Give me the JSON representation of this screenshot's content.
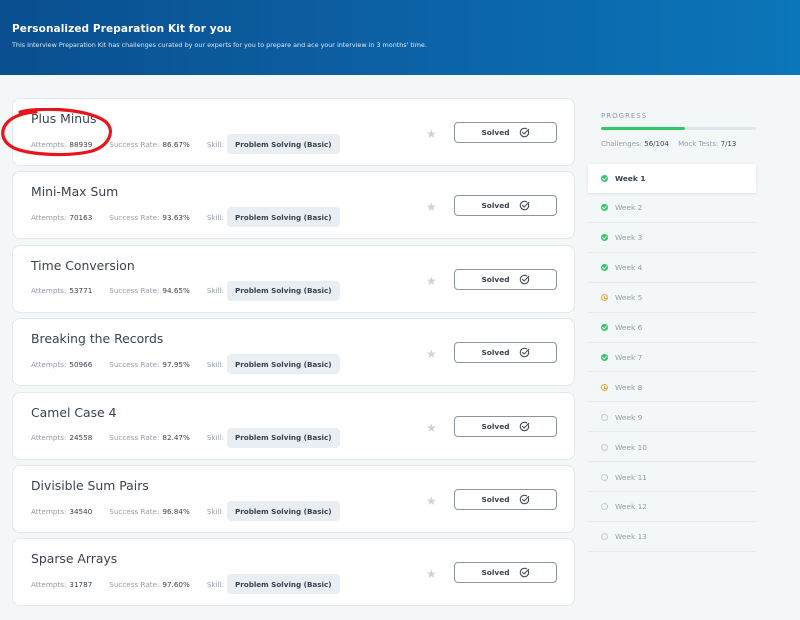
{
  "banner": {
    "title": "Personalized Preparation Kit for you",
    "subtitle": "This Interview Preparation Kit has challenges curated by our experts for you to prepare and ace your interview in 3 months' time."
  },
  "labels": {
    "attempts": "Attempts:",
    "success_rate": "Success Rate:",
    "skill": "Skill:",
    "solved": "Solved"
  },
  "challenges": [
    {
      "title": "Plus Minus",
      "attempts": "88939",
      "success_rate": "86.67%",
      "skill": "Problem Solving (Basic)"
    },
    {
      "title": "Mini-Max Sum",
      "attempts": "70163",
      "success_rate": "93.63%",
      "skill": "Problem Solving (Basic)"
    },
    {
      "title": "Time Conversion",
      "attempts": "53771",
      "success_rate": "94.65%",
      "skill": "Problem Solving (Basic)"
    },
    {
      "title": "Breaking the Records",
      "attempts": "50966",
      "success_rate": "97.95%",
      "skill": "Problem Solving (Basic)"
    },
    {
      "title": "Camel Case 4",
      "attempts": "24558",
      "success_rate": "82.47%",
      "skill": "Problem Solving (Basic)"
    },
    {
      "title": "Divisible Sum Pairs",
      "attempts": "34540",
      "success_rate": "96.84%",
      "skill": "Problem Solving (Basic)"
    },
    {
      "title": "Sparse Arrays",
      "attempts": "31787",
      "success_rate": "97.60%",
      "skill": "Problem Solving (Basic)"
    }
  ],
  "progress": {
    "label": "PROGRESS",
    "fraction": 0.54,
    "challenges_label": "Challenges:",
    "challenges_value": "56/104",
    "mock_label": "Mock Tests:",
    "mock_value": "7/13"
  },
  "weeks": [
    {
      "label": "Week 1",
      "status": "done",
      "active": true
    },
    {
      "label": "Week 2",
      "status": "done"
    },
    {
      "label": "Week 3",
      "status": "done"
    },
    {
      "label": "Week 4",
      "status": "done"
    },
    {
      "label": "Week 5",
      "status": "progress"
    },
    {
      "label": "Week 6",
      "status": "done"
    },
    {
      "label": "Week 7",
      "status": "done"
    },
    {
      "label": "Week 8",
      "status": "progress"
    },
    {
      "label": "Week 9",
      "status": "pending"
    },
    {
      "label": "Week 10",
      "status": "pending"
    },
    {
      "label": "Week 11",
      "status": "pending"
    },
    {
      "label": "Week 12",
      "status": "pending"
    },
    {
      "label": "Week 13",
      "status": "pending"
    }
  ],
  "colors": {
    "banner_start": "#0a4f8f",
    "banner_end": "#0b76b9",
    "success_green": "#2ec866",
    "in_progress_orange": "#f0a53a",
    "annotation_red": "#e8141b"
  },
  "icons": {
    "star": "star-icon",
    "solved": "check-circle-icon",
    "week_done": "check-circle-filled-icon",
    "week_progress": "clock-icon",
    "week_pending": "empty-circle-icon"
  }
}
